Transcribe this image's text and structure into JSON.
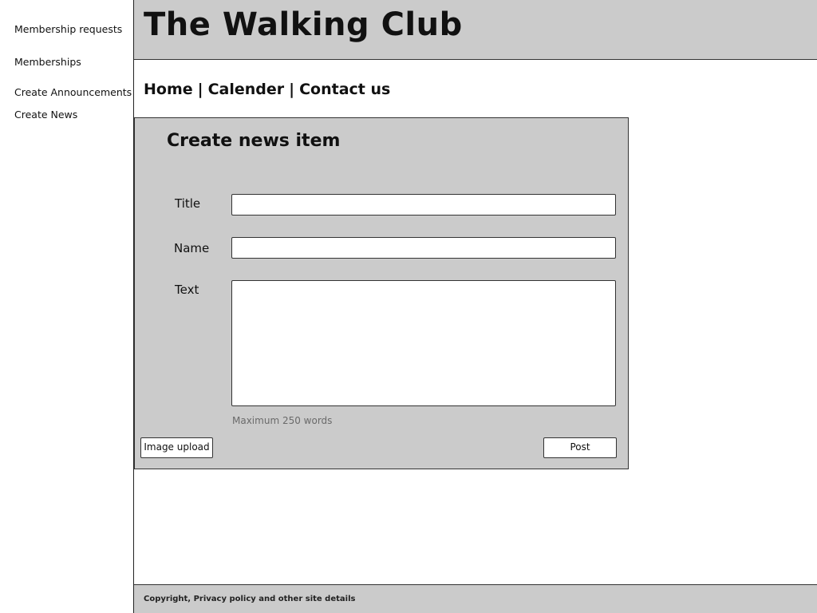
{
  "header": {
    "title": "The Walking Club"
  },
  "sidebar": {
    "items": [
      {
        "label": "Membership requests"
      },
      {
        "label": "Memberships"
      },
      {
        "label": "Create Announcements"
      },
      {
        "label": "Create News"
      }
    ]
  },
  "nav": {
    "links": [
      {
        "label": "Home"
      },
      {
        "label": "Calender"
      },
      {
        "label": "Contact us"
      }
    ],
    "separator": "|"
  },
  "form": {
    "heading": "Create news item",
    "title_label": "Title",
    "title_value": "",
    "name_label": "Name",
    "name_value": "",
    "text_label": "Text",
    "text_value": "",
    "hint": "Maximum 250 words",
    "upload_label": "Image upload",
    "post_label": "Post"
  },
  "footer": {
    "text": "Copyright, Privacy policy and other site details"
  },
  "colors": {
    "panel_background": "#cbcbcb",
    "page_background": "#ffffff",
    "hint_text": "#6a6a6a"
  }
}
